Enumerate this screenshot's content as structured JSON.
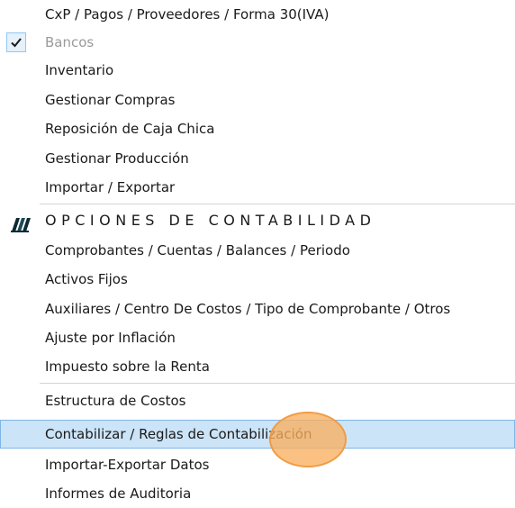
{
  "menu": {
    "items": [
      {
        "label": "CxP / Pagos / Proveedores / Forma 30(IVA)"
      },
      {
        "label": "Bancos",
        "checked": true,
        "disabled": true
      },
      {
        "label": "Inventario"
      },
      {
        "label": "Gestionar Compras"
      },
      {
        "label": "Reposición de Caja Chica"
      },
      {
        "label": "Gestionar Producción"
      },
      {
        "label": "Importar / Exportar"
      },
      {
        "label": "OPCIONES DE CONTABILIDAD",
        "icon": "accounting-books-icon"
      },
      {
        "label": "Comprobantes / Cuentas / Balances / Periodo"
      },
      {
        "label": "Activos Fijos"
      },
      {
        "label": "Auxiliares / Centro De Costos / Tipo de Comprobante / Otros"
      },
      {
        "label": "Ajuste por Inflación"
      },
      {
        "label": "Impuesto sobre la Renta"
      },
      {
        "label": "Estructura de Costos"
      },
      {
        "label": "Contabilizar / Reglas de Contabilización",
        "highlighted": true
      },
      {
        "label": "Importar-Exportar Datos"
      },
      {
        "label": "Informes de Auditoria"
      }
    ]
  },
  "colors": {
    "highlight_bg": "#cce4f7",
    "highlight_border": "#7fb6e6",
    "cursor_marker": "#f7a95c",
    "disabled_text": "#9a9a9a"
  }
}
